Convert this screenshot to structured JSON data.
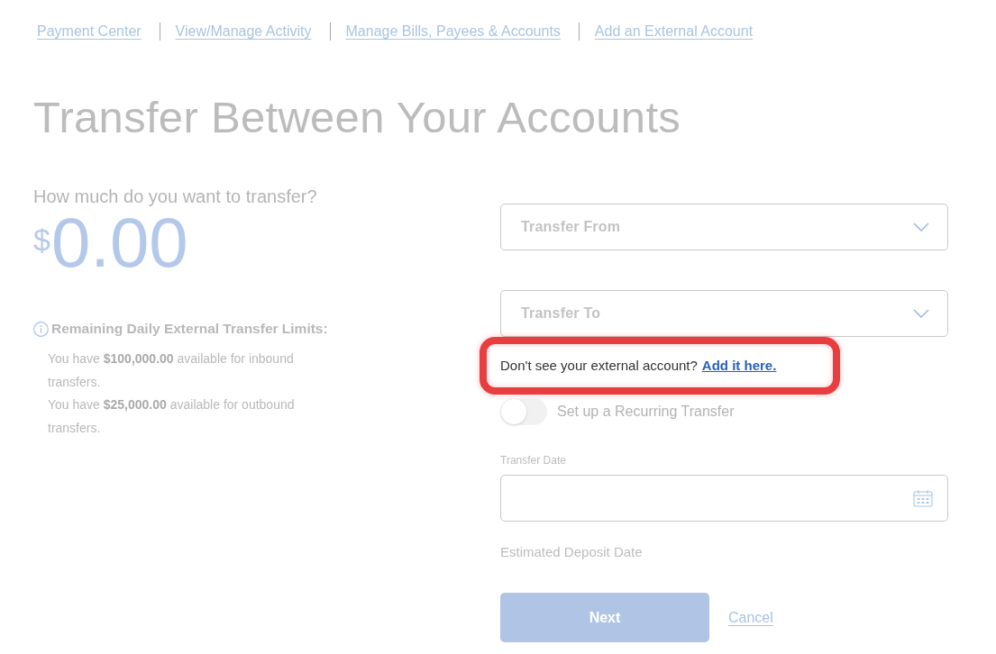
{
  "nav_links": [
    {
      "label": "Payment Center"
    },
    {
      "label": "View/Manage Activity"
    },
    {
      "label": "Manage Bills, Payees & Accounts"
    },
    {
      "label": "Add an External Account"
    }
  ],
  "title": "Transfer Between Your Accounts",
  "amount": {
    "prompt": "How much do you want to transfer?",
    "currency": "$",
    "value": "0.00"
  },
  "limits": {
    "heading": "Remaining Daily External Transfer Limits:",
    "lines": [
      "You have **$100,000.00** available for inbound transfers.",
      "You have **$25,000.00** available for outbound transfers."
    ]
  },
  "form": {
    "selects": [
      {
        "placeholder": "Transfer From"
      },
      {
        "placeholder": "Transfer To"
      }
    ],
    "callout": {
      "text": "Don't see your external account?",
      "link": "Add it here.",
      "highlighted": true
    },
    "recurring": {
      "label": "Set up a Recurring Transfer",
      "on": false
    },
    "transfer_date": {
      "label": "Transfer Date"
    },
    "estimated_deposit": {
      "label": "Estimated Deposit Date"
    },
    "actions": [
      {
        "label": "Next",
        "kind": "primary"
      },
      {
        "label": "Cancel",
        "kind": "link"
      }
    ]
  }
}
